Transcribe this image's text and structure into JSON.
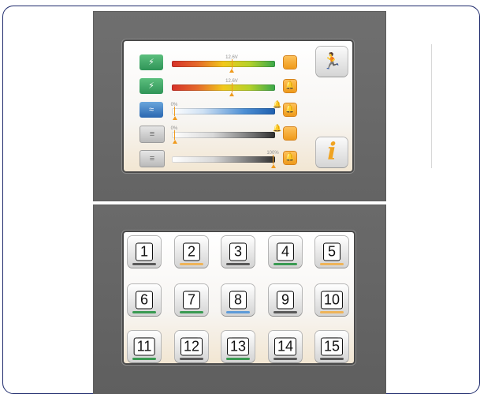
{
  "monitor": {
    "rows": [
      {
        "id": "battery-1",
        "icon": "battery-icon",
        "glyph": "⚡",
        "icon_style": "green",
        "value_label": "12.6V",
        "value_pct": 58,
        "bar": "fuel",
        "alarm_icon": "alarm-square-icon",
        "alarm_glyph": "",
        "has_bell_marker": false
      },
      {
        "id": "battery-2",
        "icon": "battery-icon",
        "glyph": "⚡",
        "icon_style": "green",
        "value_label": "12.6V",
        "value_pct": 58,
        "bar": "fuel",
        "alarm_icon": "bell-icon",
        "alarm_glyph": "🔔",
        "has_bell_marker": false
      },
      {
        "id": "fresh-water",
        "icon": "water-tank-icon",
        "glyph": "≈",
        "icon_style": "blue",
        "value_label": "0%",
        "value_pct": 0,
        "bar": "water",
        "alarm_icon": "bell-icon",
        "alarm_glyph": "🔔",
        "has_bell_marker": true
      },
      {
        "id": "grey-water",
        "icon": "grey-tank-icon",
        "glyph": "≡",
        "icon_style": "grey",
        "value_label": "0%",
        "value_pct": 0,
        "bar": "grey",
        "alarm_icon": "alarm-square-icon",
        "alarm_glyph": "",
        "has_bell_marker": true
      },
      {
        "id": "black-water",
        "icon": "black-tank-icon",
        "glyph": "≡",
        "icon_style": "grey",
        "value_label": "100%",
        "value_pct": 100,
        "bar": "grey",
        "alarm_icon": "bell-icon",
        "alarm_glyph": "🔔",
        "has_bell_marker": false
      }
    ],
    "exit_icon": "exit-door-icon",
    "exit_glyph": "🏃",
    "info_icon": "info-icon",
    "info_glyph": "i"
  },
  "menu": {
    "buttons": [
      {
        "label": "1",
        "icon": "settings-icon",
        "deco": "dark"
      },
      {
        "label": "2",
        "icon": "light-icon",
        "deco": "orange"
      },
      {
        "label": "3",
        "icon": "thermometer-icon",
        "deco": "dark"
      },
      {
        "label": "4",
        "icon": "battery-icon",
        "deco": "green"
      },
      {
        "label": "5",
        "icon": "sun-icon",
        "deco": "orange"
      },
      {
        "label": "6",
        "icon": "battery-icon",
        "deco": "green"
      },
      {
        "label": "7",
        "icon": "charger-icon",
        "deco": "green"
      },
      {
        "label": "8",
        "icon": "water-icon",
        "deco": "blue"
      },
      {
        "label": "9",
        "icon": "tank-icon",
        "deco": "dark"
      },
      {
        "label": "10",
        "icon": "light-icon",
        "deco": "orange"
      },
      {
        "label": "11",
        "icon": "lamp-icon",
        "deco": "green"
      },
      {
        "label": "12",
        "icon": "gas-icon",
        "deco": "dark"
      },
      {
        "label": "13",
        "icon": "fan-icon",
        "deco": "green"
      },
      {
        "label": "14",
        "icon": "pump-icon",
        "deco": "dark"
      },
      {
        "label": "15",
        "icon": "socket-icon",
        "deco": "dark"
      }
    ]
  }
}
